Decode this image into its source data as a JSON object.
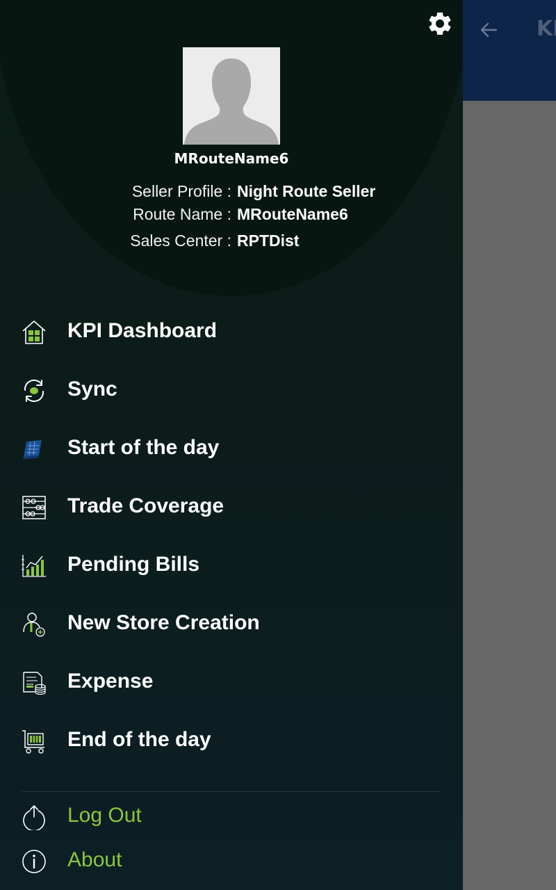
{
  "background_app": {
    "title": "KI",
    "toolbar_color": "#0c2548"
  },
  "drawer": {
    "settings_icon": "gear-icon",
    "profile": {
      "name": "MRouteName6",
      "seller_profile_label": "Seller Profile :",
      "seller_profile_value": "Night Route Seller",
      "route_name_label": "Route Name :",
      "route_name_value": "MRouteName6",
      "sales_center_label": "Sales Center :",
      "sales_center_value": "RPTDist"
    },
    "menu": [
      {
        "label": "KPI Dashboard",
        "icon": "dashboard-home-icon"
      },
      {
        "label": "Sync",
        "icon": "sync-icon"
      },
      {
        "label": "Start of the day",
        "icon": "calendar-icon"
      },
      {
        "label": "Trade Coverage",
        "icon": "abacus-icon"
      },
      {
        "label": "Pending Bills",
        "icon": "bar-chart-icon"
      },
      {
        "label": "New Store Creation",
        "icon": "add-person-icon"
      },
      {
        "label": "Expense",
        "icon": "expense-icon"
      },
      {
        "label": "End of the day",
        "icon": "cart-icon"
      }
    ],
    "bottom": [
      {
        "label": "Log Out",
        "icon": "power-icon"
      },
      {
        "label": "About",
        "icon": "info-icon"
      }
    ],
    "accent_color": "#8cc63f"
  }
}
